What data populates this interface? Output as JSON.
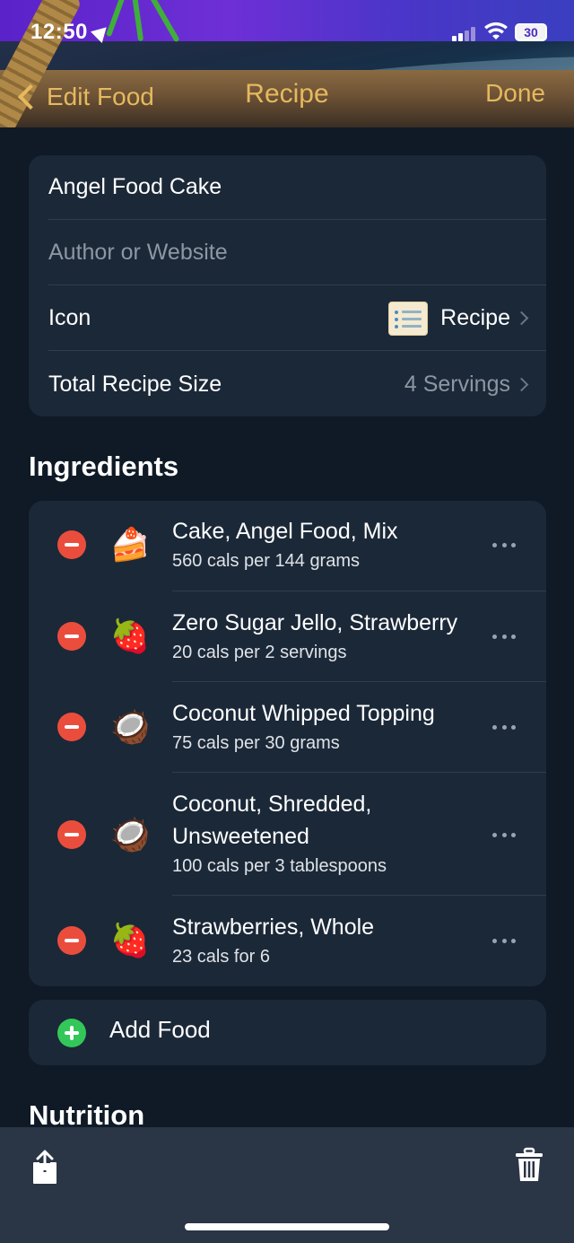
{
  "status_bar": {
    "time": "12:50",
    "battery": "30"
  },
  "nav": {
    "back_label": "Edit Food",
    "title": "Recipe",
    "done_label": "Done"
  },
  "form": {
    "name_value": "Angel Food Cake",
    "author_placeholder": "Author or Website",
    "icon_label": "Icon",
    "icon_value": "Recipe",
    "size_label": "Total Recipe Size",
    "size_value": "4 Servings"
  },
  "ingredients_title": "Ingredients",
  "ingredients": [
    {
      "emoji": "🍰",
      "name": "Cake, Angel Food, Mix",
      "detail": "560 cals per 144 grams"
    },
    {
      "emoji": "🍓",
      "name": "Zero Sugar Jello, Strawberry",
      "detail": "20 cals per 2 servings"
    },
    {
      "emoji": "🥥",
      "name": "Coconut Whipped Topping",
      "detail": "75 cals per 30 grams"
    },
    {
      "emoji": "🥥",
      "name": "Coconut, Shredded, Unsweetened",
      "detail": "100 cals per 3 tablespoons"
    },
    {
      "emoji": "🍓",
      "name": "Strawberries, Whole",
      "detail": "23 cals for 6"
    }
  ],
  "add_food_label": "Add Food",
  "nutrition_title": "Nutrition",
  "colors": {
    "accent": "#e5b95e",
    "remove": "#eb4d3d",
    "add": "#33c759",
    "background": "#0f1a26",
    "card": "#1b2838"
  },
  "icons": {
    "share": "share-icon",
    "trash": "trash-icon"
  }
}
